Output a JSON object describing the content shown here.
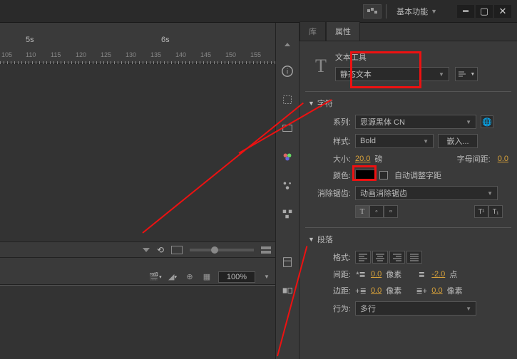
{
  "top": {
    "workspace": "基本功能"
  },
  "timeline": {
    "marks": [
      "5s",
      "6s"
    ],
    "ticks": [
      "105",
      "110",
      "115",
      "120",
      "125",
      "130",
      "135",
      "140",
      "145",
      "150",
      "155"
    ],
    "zoom": "100%"
  },
  "panel": {
    "tabs": {
      "lib": "库",
      "props": "属性"
    },
    "tool_name": "文本工具",
    "text_type": "静态文本",
    "sec_char": "字符",
    "family_lbl": "系列:",
    "family": "思源黑体 CN",
    "style_lbl": "样式:",
    "style": "Bold",
    "embed": "嵌入...",
    "size_lbl": "大小:",
    "size_val": "20.0",
    "size_unit": "磅",
    "spacing_lbl": "字母间距:",
    "spacing_val": "0.0",
    "color_lbl": "颜色:",
    "autokern": "自动调整字距",
    "aa_lbl": "消除锯齿:",
    "aa": "动画消除锯齿",
    "sec_para": "段落",
    "format_lbl": "格式:",
    "gap_lbl": "间距:",
    "gap_left": "0.0",
    "gap_left_unit": "像素",
    "gap_right": "-2.0",
    "gap_right_unit": "点",
    "margin_lbl": "边距:",
    "margin_left": "0.0",
    "margin_left_unit": "像素",
    "margin_right": "0.0",
    "margin_right_unit": "像素",
    "behavior_lbl": "行为:",
    "behavior": "多行"
  }
}
